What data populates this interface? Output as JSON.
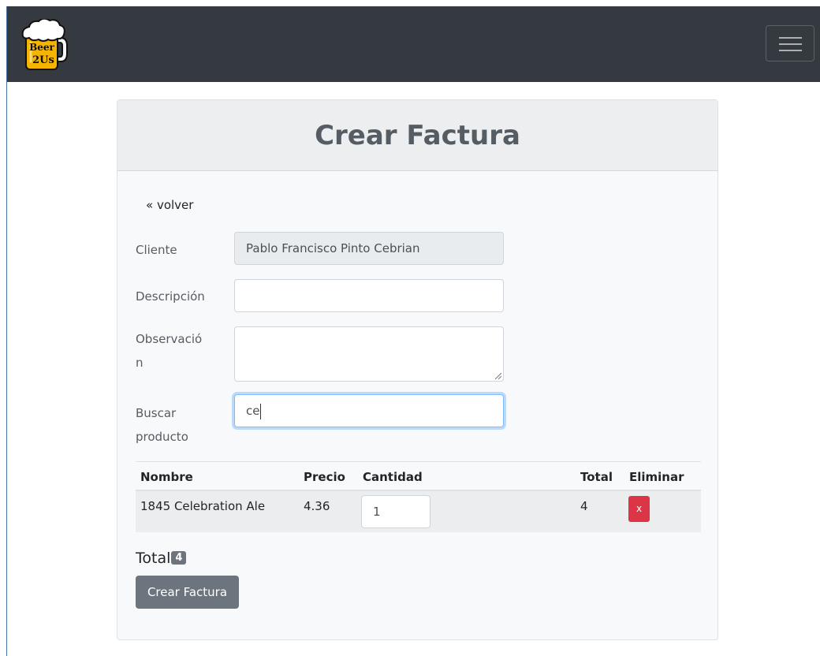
{
  "nav": {
    "menu_icon": "hamburger-icon",
    "brand_icon": "beer-mug-logo"
  },
  "card": {
    "title": "Crear Factura"
  },
  "form": {
    "back_link": "« volver",
    "client_label": "Cliente",
    "client_value": "Pablo Francisco Pinto Cebrian",
    "description_label": "Descripción",
    "description_value": "",
    "observation_label_l1": "Observació",
    "observation_label_l2": "n",
    "observation_value": "",
    "search_label_l1": "Buscar",
    "search_label_l2": "producto",
    "search_value": "ce"
  },
  "table": {
    "headers": [
      "Nombre",
      "Precio",
      "Cantidad",
      "Total",
      "Eliminar"
    ],
    "rows": [
      {
        "name": "1845 Celebration Ale",
        "price": "4.36",
        "quantity": "1",
        "total": "4",
        "delete_label": "x"
      }
    ]
  },
  "summary": {
    "total_label": "Total",
    "total_value": "4"
  },
  "actions": {
    "submit_label": "Crear Factura"
  },
  "colors": {
    "navbar": "#343a40",
    "danger": "#dc3545",
    "secondary": "#6c757d"
  }
}
